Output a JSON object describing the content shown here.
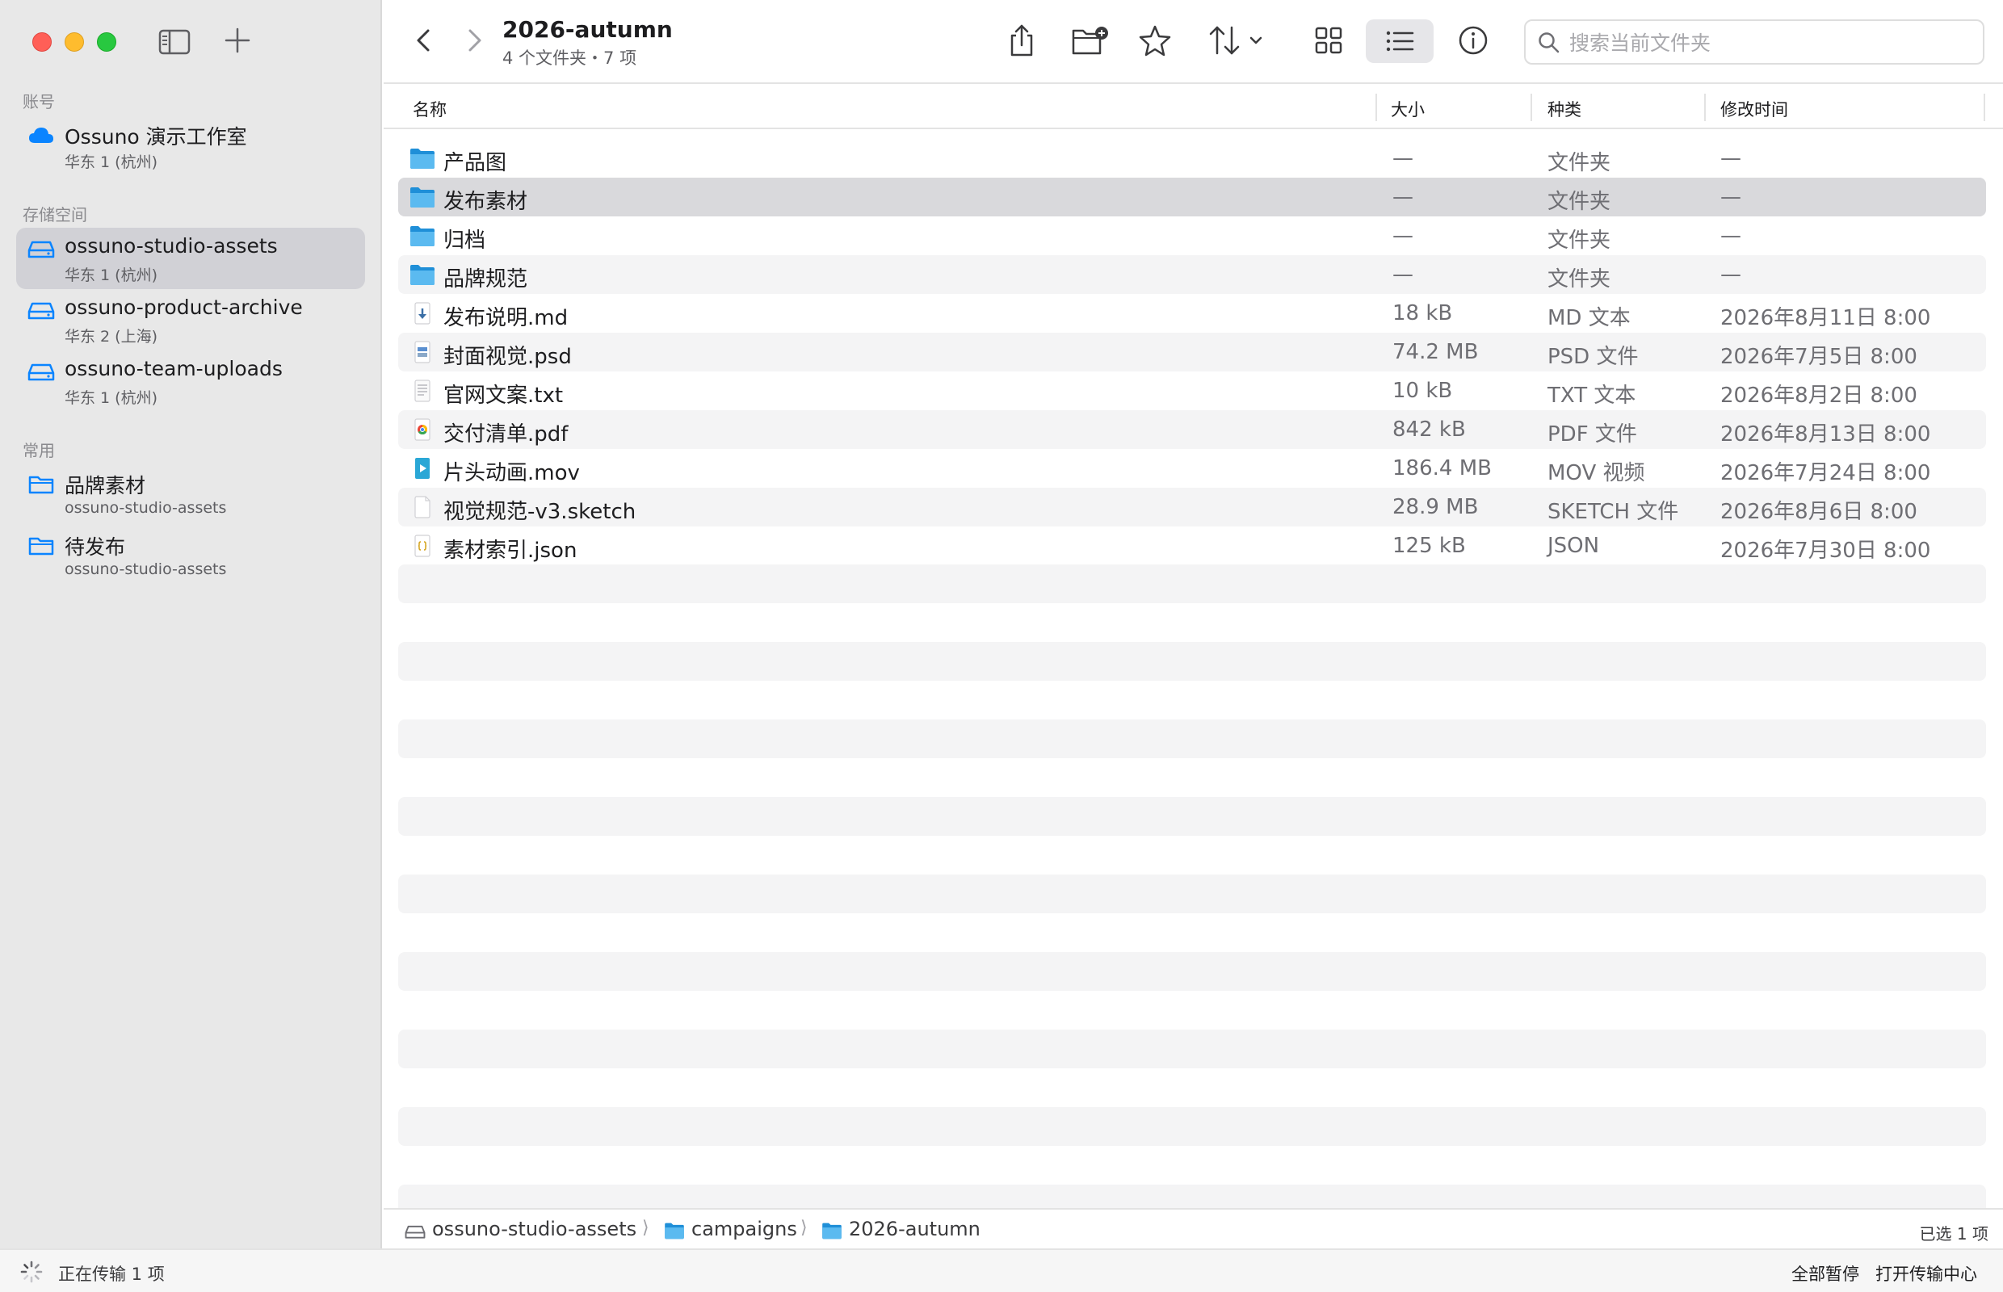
{
  "sidebar": {
    "sections": {
      "account": "账号",
      "storage": "存储空间",
      "favorites": "常用"
    },
    "account": {
      "name": "Ossuno 演示工作室",
      "region": "华东 1 (杭州)",
      "icon": "cloud-icon"
    },
    "buckets": [
      {
        "name": "ossuno-studio-assets",
        "region": "华东 1 (杭州)",
        "selected": true,
        "icon": "drive-icon"
      },
      {
        "name": "ossuno-product-archive",
        "region": "华东 2 (上海)",
        "selected": false,
        "icon": "drive-icon"
      },
      {
        "name": "ossuno-team-uploads",
        "region": "华东 1 (杭州)",
        "selected": false,
        "icon": "drive-icon"
      }
    ],
    "favorites": [
      {
        "name": "品牌素材",
        "bucket": "ossuno-studio-assets",
        "icon": "folder-outline-icon"
      },
      {
        "name": "待发布",
        "bucket": "ossuno-studio-assets",
        "icon": "folder-outline-icon"
      }
    ]
  },
  "toolbar": {
    "title": "2026-autumn",
    "subtitle": "4 个文件夹・7 项",
    "search_placeholder": "搜索当前文件夹",
    "active_view": "list"
  },
  "columns": {
    "name": "名称",
    "size": "大小",
    "kind": "种类",
    "modified": "修改时间"
  },
  "files": [
    {
      "name": "产品图",
      "size": "—",
      "kind": "文件夹",
      "modified": "—",
      "icon": "folder-icon"
    },
    {
      "name": "发布素材",
      "size": "—",
      "kind": "文件夹",
      "modified": "—",
      "icon": "folder-icon",
      "selected": true
    },
    {
      "name": "归档",
      "size": "—",
      "kind": "文件夹",
      "modified": "—",
      "icon": "folder-icon"
    },
    {
      "name": "品牌规范",
      "size": "—",
      "kind": "文件夹",
      "modified": "—",
      "icon": "folder-icon"
    },
    {
      "name": "发布说明.md",
      "size": "18 kB",
      "kind": "MD 文本",
      "modified": "2026年8月11日 8:00",
      "icon": "markdown-file-icon"
    },
    {
      "name": "封面视觉.psd",
      "size": "74.2 MB",
      "kind": "PSD 文件",
      "modified": "2026年7月5日 8:00",
      "icon": "psd-file-icon"
    },
    {
      "name": "官网文案.txt",
      "size": "10 kB",
      "kind": "TXT 文本",
      "modified": "2026年8月2日 8:00",
      "icon": "text-file-icon"
    },
    {
      "name": "交付清单.pdf",
      "size": "842 kB",
      "kind": "PDF 文件",
      "modified": "2026年8月13日 8:00",
      "icon": "pdf-file-icon"
    },
    {
      "name": "片头动画.mov",
      "size": "186.4 MB",
      "kind": "MOV 视频",
      "modified": "2026年7月24日 8:00",
      "icon": "video-file-icon"
    },
    {
      "name": "视觉规范-v3.sketch",
      "size": "28.9 MB",
      "kind": "SKETCH 文件",
      "modified": "2026年8月6日 8:00",
      "icon": "blank-file-icon"
    },
    {
      "name": "素材索引.json",
      "size": "125 kB",
      "kind": "JSON",
      "modified": "2026年7月30日 8:00",
      "icon": "json-file-icon"
    }
  ],
  "pathbar": {
    "items": [
      {
        "label": "ossuno-studio-assets",
        "icon": "drive-icon"
      },
      {
        "label": "campaigns",
        "icon": "folder-icon"
      },
      {
        "label": "2026-autumn",
        "icon": "folder-icon"
      }
    ],
    "selection": "已选 1 项"
  },
  "statusbar": {
    "transfer": "正在传输 1 项",
    "pause_all": "全部暂停",
    "open_center": "打开传输中心"
  },
  "colors": {
    "accent": "#0a84ff",
    "folder": "#3ba8e8",
    "selection_row": "#d9d9dc",
    "sidebar_bg": "#e8e8e8"
  }
}
